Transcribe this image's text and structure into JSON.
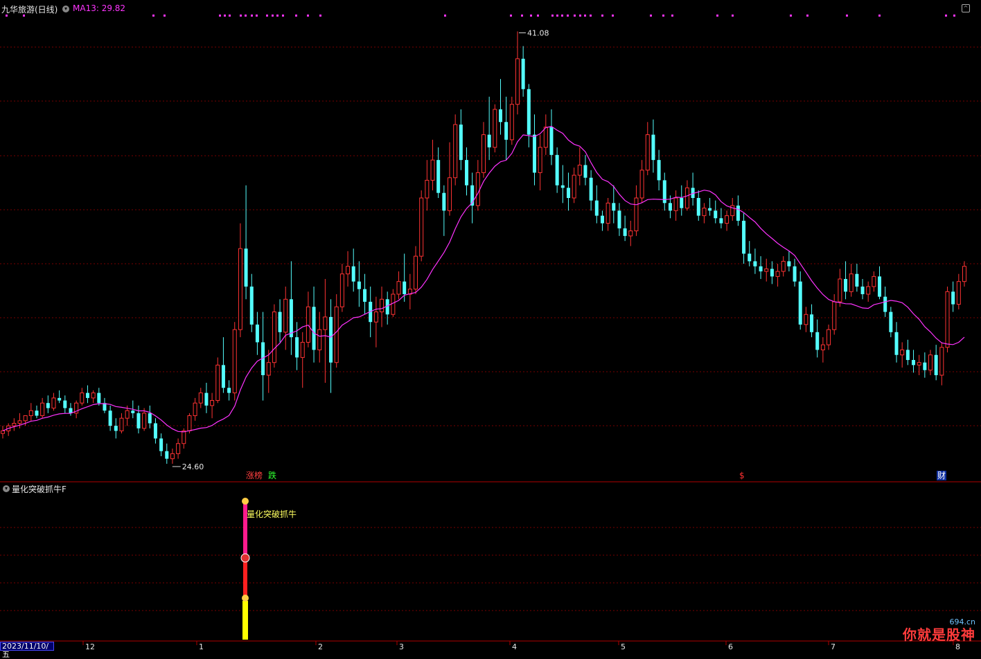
{
  "header": {
    "title": "九华旅游(日线)",
    "ma_label": "MA13: 29.82",
    "menu_icon": "chevron-down-icon"
  },
  "sub_panel": {
    "title": "量化突破抓牛F",
    "signal_text": "量化突破抓牛"
  },
  "bottom_bar": {
    "date": "2023/11/10/五",
    "months": [
      "12",
      "1",
      "2",
      "3",
      "4",
      "5",
      "6",
      "7",
      "8"
    ]
  },
  "annotations": {
    "high_label": "41.08",
    "low_label": "24.60"
  },
  "event_markers": [
    "涨榜",
    "跌",
    "$",
    "财"
  ],
  "watermark": {
    "text": "你就是股神",
    "domain": "694.cn"
  },
  "colors": {
    "up": "#ff3333",
    "down": "#54ffff",
    "ma": "#ff33ff",
    "grid": "#7a0000",
    "signal_pink": "#ff1a8c",
    "signal_yellow": "#ffff00"
  },
  "chart_data": {
    "type": "candlestick",
    "symbol": "九华旅游",
    "period": "日线",
    "series": [
      {
        "name": "MA13",
        "last_value": 29.82
      }
    ],
    "candles": [
      [
        25.2,
        25.5,
        25.0,
        25.3
      ],
      [
        25.3,
        25.6,
        25.1,
        25.5
      ],
      [
        25.5,
        25.8,
        25.3,
        25.6
      ],
      [
        25.6,
        26.0,
        25.4,
        25.7
      ],
      [
        25.7,
        25.9,
        25.5,
        25.9
      ],
      [
        25.9,
        26.4,
        25.7,
        26.1
      ],
      [
        26.1,
        26.3,
        25.8,
        25.9
      ],
      [
        25.9,
        26.6,
        25.8,
        26.4
      ],
      [
        26.4,
        26.7,
        26.0,
        26.2
      ],
      [
        26.2,
        26.8,
        26.1,
        26.6
      ],
      [
        26.6,
        26.9,
        26.4,
        26.5
      ],
      [
        26.5,
        26.7,
        26.0,
        26.2
      ],
      [
        26.2,
        26.4,
        25.9,
        26.0
      ],
      [
        26.0,
        26.5,
        25.8,
        26.4
      ],
      [
        26.4,
        27.0,
        26.3,
        26.8
      ],
      [
        26.8,
        27.1,
        26.4,
        26.6
      ],
      [
        26.6,
        26.9,
        26.4,
        26.8
      ],
      [
        26.8,
        27.0,
        26.3,
        26.4
      ],
      [
        26.4,
        26.6,
        26.0,
        26.1
      ],
      [
        26.1,
        26.3,
        25.3,
        25.5
      ],
      [
        25.5,
        25.8,
        25.0,
        25.3
      ],
      [
        25.3,
        26.0,
        25.2,
        25.8
      ],
      [
        25.8,
        26.3,
        25.5,
        26.1
      ],
      [
        26.1,
        26.5,
        25.8,
        26.0
      ],
      [
        26.0,
        26.3,
        25.2,
        25.4
      ],
      [
        25.4,
        26.2,
        25.3,
        26.0
      ],
      [
        26.0,
        26.3,
        25.4,
        25.6
      ],
      [
        25.6,
        25.8,
        24.8,
        25.0
      ],
      [
        25.0,
        25.2,
        24.3,
        24.5
      ],
      [
        24.5,
        24.8,
        24.0,
        24.2
      ],
      [
        24.2,
        24.6,
        24.0,
        24.4
      ],
      [
        24.4,
        25.0,
        24.2,
        24.8
      ],
      [
        24.8,
        25.4,
        24.6,
        25.3
      ],
      [
        25.3,
        26.0,
        25.2,
        25.9
      ],
      [
        25.9,
        26.6,
        25.7,
        26.4
      ],
      [
        26.4,
        27.0,
        26.2,
        26.8
      ],
      [
        26.8,
        27.2,
        26.0,
        26.3
      ],
      [
        26.3,
        26.8,
        25.8,
        26.5
      ],
      [
        26.5,
        28.2,
        26.4,
        27.9
      ],
      [
        27.9,
        29.0,
        26.8,
        27.0
      ],
      [
        27.0,
        27.3,
        26.5,
        26.8
      ],
      [
        26.8,
        29.6,
        26.5,
        29.3
      ],
      [
        29.3,
        33.5,
        29.0,
        32.5
      ],
      [
        32.5,
        35.0,
        30.5,
        31.0
      ],
      [
        31.0,
        31.5,
        29.2,
        29.5
      ],
      [
        29.5,
        30.0,
        28.3,
        28.8
      ],
      [
        28.8,
        30.0,
        26.5,
        27.5
      ],
      [
        27.5,
        28.5,
        26.8,
        28.0
      ],
      [
        28.0,
        30.3,
        27.8,
        30.0
      ],
      [
        30.0,
        30.5,
        28.8,
        29.2
      ],
      [
        29.2,
        31.0,
        28.5,
        30.5
      ],
      [
        30.5,
        32.0,
        28.3,
        29.0
      ],
      [
        29.0,
        29.6,
        27.7,
        28.2
      ],
      [
        28.2,
        29.2,
        27.0,
        28.8
      ],
      [
        28.8,
        30.8,
        28.6,
        30.2
      ],
      [
        30.2,
        31.0,
        28.0,
        28.5
      ],
      [
        28.5,
        30.0,
        28.0,
        29.3
      ],
      [
        29.3,
        31.3,
        27.2,
        29.8
      ],
      [
        29.8,
        30.5,
        26.8,
        28.0
      ],
      [
        28.0,
        30.7,
        27.8,
        30.2
      ],
      [
        30.2,
        31.9,
        30.0,
        31.5
      ],
      [
        31.5,
        32.4,
        31.0,
        31.8
      ],
      [
        31.8,
        32.5,
        30.8,
        31.2
      ],
      [
        31.2,
        32.0,
        30.2,
        30.9
      ],
      [
        30.9,
        31.5,
        29.9,
        30.4
      ],
      [
        30.4,
        31.0,
        29.0,
        29.6
      ],
      [
        29.6,
        30.6,
        28.6,
        30.0
      ],
      [
        30.0,
        31.0,
        29.4,
        30.5
      ],
      [
        30.5,
        30.8,
        29.5,
        29.9
      ],
      [
        29.9,
        30.9,
        29.8,
        30.7
      ],
      [
        30.7,
        31.6,
        30.5,
        31.2
      ],
      [
        31.2,
        32.3,
        30.4,
        30.7
      ],
      [
        30.7,
        31.5,
        30.1,
        30.9
      ],
      [
        30.9,
        32.6,
        30.7,
        32.2
      ],
      [
        32.2,
        34.8,
        32.0,
        34.5
      ],
      [
        34.5,
        36.0,
        34.0,
        35.2
      ],
      [
        35.2,
        36.8,
        34.8,
        36.0
      ],
      [
        36.0,
        36.5,
        34.5,
        34.7
      ],
      [
        34.7,
        35.0,
        33.0,
        34.0
      ],
      [
        34.0,
        36.7,
        33.8,
        35.3
      ],
      [
        35.3,
        37.8,
        35.0,
        37.4
      ],
      [
        37.4,
        38.0,
        35.6,
        36.0
      ],
      [
        36.0,
        36.5,
        34.6,
        35.0
      ],
      [
        35.0,
        35.5,
        33.5,
        34.2
      ],
      [
        34.2,
        36.0,
        34.0,
        35.5
      ],
      [
        35.5,
        37.5,
        35.3,
        37.0
      ],
      [
        37.0,
        38.5,
        36.0,
        36.5
      ],
      [
        36.5,
        38.2,
        36.3,
        38.0
      ],
      [
        38.0,
        39.2,
        37.0,
        37.5
      ],
      [
        37.5,
        38.5,
        36.0,
        36.8
      ],
      [
        36.8,
        38.5,
        36.6,
        38.2
      ],
      [
        38.2,
        41.08,
        37.8,
        40.0
      ],
      [
        40.0,
        40.5,
        38.5,
        38.8
      ],
      [
        38.8,
        39.0,
        36.5,
        37.0
      ],
      [
        37.0,
        37.8,
        35.0,
        35.5
      ],
      [
        35.5,
        37.0,
        34.8,
        36.5
      ],
      [
        36.5,
        37.8,
        36.2,
        37.3
      ],
      [
        37.3,
        38.0,
        35.8,
        36.2
      ],
      [
        36.2,
        36.5,
        34.7,
        35.0
      ],
      [
        35.0,
        35.8,
        34.3,
        34.9
      ],
      [
        34.9,
        35.5,
        34.0,
        34.5
      ],
      [
        34.5,
        35.7,
        34.3,
        35.4
      ],
      [
        35.4,
        36.5,
        35.0,
        35.8
      ],
      [
        35.8,
        36.2,
        35.0,
        35.3
      ],
      [
        35.3,
        35.6,
        34.0,
        34.4
      ],
      [
        34.4,
        35.0,
        33.5,
        33.8
      ],
      [
        33.8,
        34.0,
        33.2,
        33.5
      ],
      [
        33.5,
        34.5,
        33.2,
        34.3
      ],
      [
        34.3,
        35.0,
        33.5,
        34.0
      ],
      [
        34.0,
        34.3,
        33.0,
        33.3
      ],
      [
        33.3,
        33.8,
        32.8,
        33.0
      ],
      [
        33.0,
        33.6,
        32.6,
        33.2
      ],
      [
        33.2,
        35.0,
        33.0,
        34.5
      ],
      [
        34.5,
        36.0,
        34.3,
        35.6
      ],
      [
        35.6,
        37.5,
        35.4,
        37.0
      ],
      [
        37.0,
        37.6,
        35.5,
        36.0
      ],
      [
        36.0,
        36.4,
        34.8,
        35.2
      ],
      [
        35.2,
        35.5,
        34.0,
        34.3
      ],
      [
        34.3,
        34.6,
        33.7,
        34.0
      ],
      [
        34.0,
        34.8,
        33.6,
        34.5
      ],
      [
        34.5,
        35.0,
        33.8,
        34.1
      ],
      [
        34.1,
        35.2,
        34.0,
        34.9
      ],
      [
        34.9,
        35.5,
        34.2,
        34.5
      ],
      [
        34.5,
        34.8,
        33.6,
        33.8
      ],
      [
        33.8,
        34.3,
        33.5,
        34.1
      ],
      [
        34.1,
        34.5,
        33.8,
        34.0
      ],
      [
        34.0,
        34.4,
        33.5,
        33.7
      ],
      [
        33.7,
        34.1,
        33.3,
        33.5
      ],
      [
        33.5,
        34.0,
        33.2,
        33.8
      ],
      [
        33.8,
        34.5,
        33.6,
        34.2
      ],
      [
        34.2,
        34.6,
        33.4,
        33.6
      ],
      [
        33.6,
        33.9,
        31.9,
        32.3
      ],
      [
        32.3,
        32.8,
        31.8,
        32.0
      ],
      [
        32.0,
        32.5,
        31.5,
        31.8
      ],
      [
        31.8,
        32.2,
        31.3,
        31.6
      ],
      [
        31.6,
        32.1,
        31.2,
        31.7
      ],
      [
        31.7,
        32.0,
        31.1,
        31.4
      ],
      [
        31.4,
        31.9,
        31.0,
        31.6
      ],
      [
        31.6,
        32.2,
        31.4,
        32.0
      ],
      [
        32.0,
        32.4,
        31.6,
        31.8
      ],
      [
        31.8,
        32.1,
        31.0,
        31.2
      ],
      [
        31.2,
        31.6,
        29.3,
        29.5
      ],
      [
        29.5,
        30.2,
        29.2,
        29.9
      ],
      [
        29.9,
        30.3,
        29.0,
        29.2
      ],
      [
        29.2,
        29.7,
        28.2,
        28.5
      ],
      [
        28.5,
        29.0,
        28.0,
        28.7
      ],
      [
        28.7,
        29.5,
        28.5,
        29.3
      ],
      [
        29.3,
        30.7,
        29.1,
        30.4
      ],
      [
        30.4,
        31.7,
        30.2,
        31.3
      ],
      [
        31.3,
        32.0,
        30.5,
        30.8
      ],
      [
        30.8,
        31.9,
        30.6,
        31.5
      ],
      [
        31.5,
        31.9,
        30.8,
        31.0
      ],
      [
        31.0,
        31.3,
        30.5,
        30.7
      ],
      [
        30.7,
        31.2,
        30.4,
        31.0
      ],
      [
        31.0,
        31.6,
        30.8,
        31.4
      ],
      [
        31.4,
        31.8,
        30.5,
        30.6
      ],
      [
        30.6,
        31.0,
        29.8,
        30.0
      ],
      [
        30.0,
        30.2,
        29.0,
        29.2
      ],
      [
        29.2,
        29.6,
        28.0,
        28.3
      ],
      [
        28.3,
        28.8,
        27.8,
        28.5
      ],
      [
        28.5,
        28.9,
        27.9,
        28.1
      ],
      [
        28.1,
        28.5,
        27.6,
        27.9
      ],
      [
        27.9,
        28.3,
        27.5,
        28.0
      ],
      [
        28.0,
        28.4,
        27.4,
        27.7
      ],
      [
        27.7,
        28.5,
        27.5,
        28.3
      ],
      [
        28.3,
        28.7,
        27.3,
        27.5
      ],
      [
        27.5,
        28.8,
        27.1,
        28.6
      ],
      [
        28.6,
        31.0,
        28.4,
        30.8
      ],
      [
        30.8,
        31.2,
        30.0,
        30.3
      ],
      [
        30.3,
        31.5,
        30.1,
        31.2
      ],
      [
        31.2,
        32.0,
        31.0,
        31.8
      ]
    ]
  }
}
